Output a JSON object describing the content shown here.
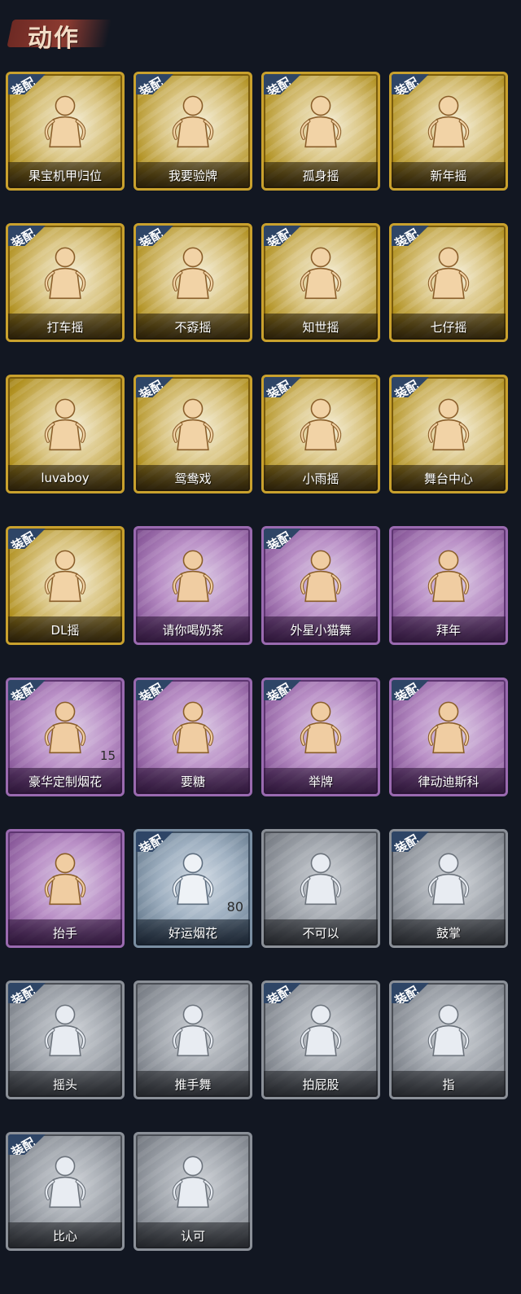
{
  "section": {
    "title": "动作"
  },
  "badge_label": "装配",
  "colors": {
    "gold": "#c9a12d",
    "purple": "#9a6ab0",
    "blue": "#7a8ea2",
    "grey": "#8b9098",
    "badge": "#2e4566",
    "header_brush": "#8d3b31"
  },
  "cards": [
    {
      "label": "果宝机甲归位",
      "rarity": "gold",
      "equipped": true,
      "icon": "pose-arms-akimbo-icon"
    },
    {
      "label": "我要验牌",
      "rarity": "gold",
      "equipped": true,
      "icon": "pose-show-card-icon"
    },
    {
      "label": "孤身摇",
      "rarity": "gold",
      "equipped": true,
      "icon": "pose-dance-stars-icon"
    },
    {
      "label": "新年摇",
      "rarity": "gold",
      "equipped": true,
      "icon": "pose-cross-arms-icon"
    },
    {
      "label": "打车摇",
      "rarity": "gold",
      "equipped": true,
      "icon": "pose-hail-icon"
    },
    {
      "label": "不孬摇",
      "rarity": "gold",
      "equipped": true,
      "icon": "pose-arm-up-icon"
    },
    {
      "label": "知世摇",
      "rarity": "gold",
      "equipped": true,
      "icon": "pose-hands-out-icon"
    },
    {
      "label": "七仔摇",
      "rarity": "gold",
      "equipped": true,
      "icon": "pose-point-icon"
    },
    {
      "label": "luvaboy",
      "rarity": "gold",
      "equipped": false,
      "icon": "pose-hug-icon"
    },
    {
      "label": "鸳鸯戏",
      "rarity": "gold",
      "equipped": true,
      "icon": "pose-sway-icon"
    },
    {
      "label": "小雨摇",
      "rarity": "gold",
      "equipped": true,
      "icon": "pose-wave-icon"
    },
    {
      "label": "舞台中心",
      "rarity": "gold",
      "equipped": true,
      "icon": "pose-star-pose-icon"
    },
    {
      "label": "DL摇",
      "rarity": "gold",
      "equipped": true,
      "icon": "pose-raise-arm-icon"
    },
    {
      "label": "请你喝奶茶",
      "rarity": "purple",
      "equipped": false,
      "icon": "pose-hold-sign-icon"
    },
    {
      "label": "外星小猫舞",
      "rarity": "purple",
      "equipped": true,
      "icon": "pose-cat-dance-icon"
    },
    {
      "label": "拜年",
      "rarity": "purple",
      "equipped": false,
      "icon": "pose-bow-icon"
    },
    {
      "label": "豪华定制烟花",
      "rarity": "purple",
      "equipped": true,
      "icon": "fireworks-box-icon",
      "count": "15"
    },
    {
      "label": "要糖",
      "rarity": "purple",
      "equipped": true,
      "icon": "pose-ask-icon"
    },
    {
      "label": "举牌",
      "rarity": "purple",
      "equipped": true,
      "icon": "pose-hold-board-icon"
    },
    {
      "label": "律动迪斯科",
      "rarity": "purple",
      "equipped": true,
      "icon": "pose-disco-icon"
    },
    {
      "label": "抬手",
      "rarity": "purple",
      "equipped": false,
      "icon": "pose-lift-hand-icon"
    },
    {
      "label": "好运烟花",
      "rarity": "blue",
      "equipped": true,
      "icon": "firework-can-icon",
      "count": "80"
    },
    {
      "label": "不可以",
      "rarity": "grey",
      "equipped": false,
      "icon": "finger-no-icon"
    },
    {
      "label": "鼓掌",
      "rarity": "grey",
      "equipped": true,
      "icon": "clap-icon"
    },
    {
      "label": "摇头",
      "rarity": "grey",
      "equipped": true,
      "icon": "pose-shake-head-icon"
    },
    {
      "label": "推手舞",
      "rarity": "grey",
      "equipped": false,
      "icon": "pose-push-dance-icon"
    },
    {
      "label": "拍屁股",
      "rarity": "grey",
      "equipped": true,
      "icon": "pose-pat-icon"
    },
    {
      "label": "指",
      "rarity": "grey",
      "equipped": true,
      "icon": "pointing-hand-icon"
    },
    {
      "label": "比心",
      "rarity": "grey",
      "equipped": true,
      "icon": "finger-heart-icon"
    },
    {
      "label": "认可",
      "rarity": "grey",
      "equipped": false,
      "icon": "thumbs-up-icon"
    }
  ]
}
